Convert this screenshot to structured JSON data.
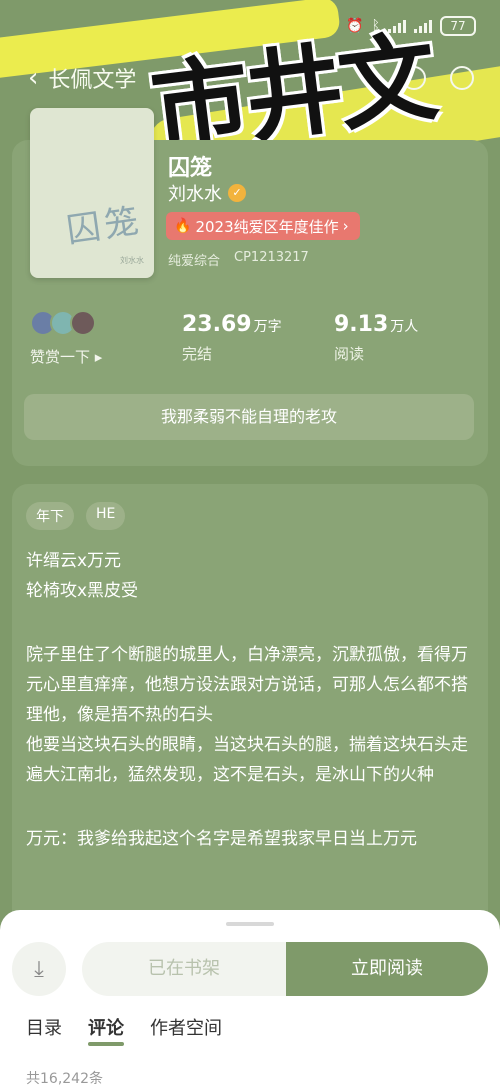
{
  "status_bar": {
    "battery": "77"
  },
  "nav": {
    "title": "长佩文学"
  },
  "watermark": "市井文",
  "book": {
    "title": "囚笼",
    "cover_title": "囚笼",
    "cover_sub": "刘水水",
    "author": "刘水水",
    "award": "2023纯爱区年度佳作",
    "category": "纯爱综合",
    "code": "CP1213217",
    "cheer_label": "赞赏一下",
    "words_value": "23.69",
    "words_unit": "万字",
    "words_label": "完结",
    "reads_value": "9.13",
    "reads_unit": "万人",
    "reads_label": "阅读",
    "tagline": "我那柔弱不能自理的老攻"
  },
  "desc": {
    "tags": [
      "年下",
      "HE"
    ],
    "line1": "许缙云x万元",
    "line2": "轮椅攻x黑皮受",
    "para1": "院子里住了个断腿的城里人，白净漂亮，沉默孤傲，看得万元心里直痒痒，他想方设法跟对方说话，可那人怎么都不搭理他，像是捂不热的石头",
    "para2": "他要当这块石头的眼睛，当这块石头的腿，揣着这块石头走遍大江南北，猛然发现，这不是石头，是冰山下的火种",
    "para3": "万元：我爹给我起这个名字是希望我家早日当上万元"
  },
  "sheet": {
    "shelf_label": "已在书架",
    "read_label": "立即阅读",
    "tab_toc": "目录",
    "tab_comments": "评论",
    "tab_author": "作者空间",
    "count": "共16,242条"
  },
  "colors": {
    "accent": "#7f9a6a",
    "highlight": "#f7f54b",
    "award": "#e8786f"
  }
}
